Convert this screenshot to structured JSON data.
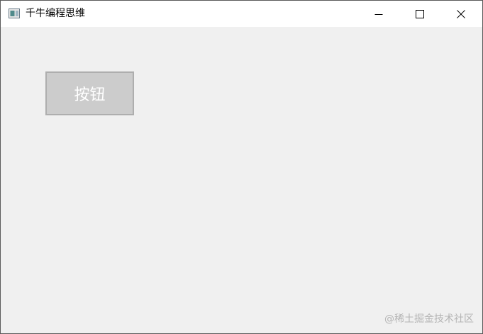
{
  "window": {
    "title": "千牛编程思维",
    "icon": "app-window-icon"
  },
  "titlebar": {
    "minimize_icon": "minimize-icon",
    "maximize_icon": "maximize-icon",
    "close_icon": "close-icon"
  },
  "content": {
    "button_label": "按钮"
  },
  "watermark": {
    "text": "@稀土掘金技术社区"
  },
  "colors": {
    "client_background": "#f0f0f0",
    "button_background": "#cccccc",
    "button_border": "#aeaeae",
    "button_text": "#ffffff"
  }
}
